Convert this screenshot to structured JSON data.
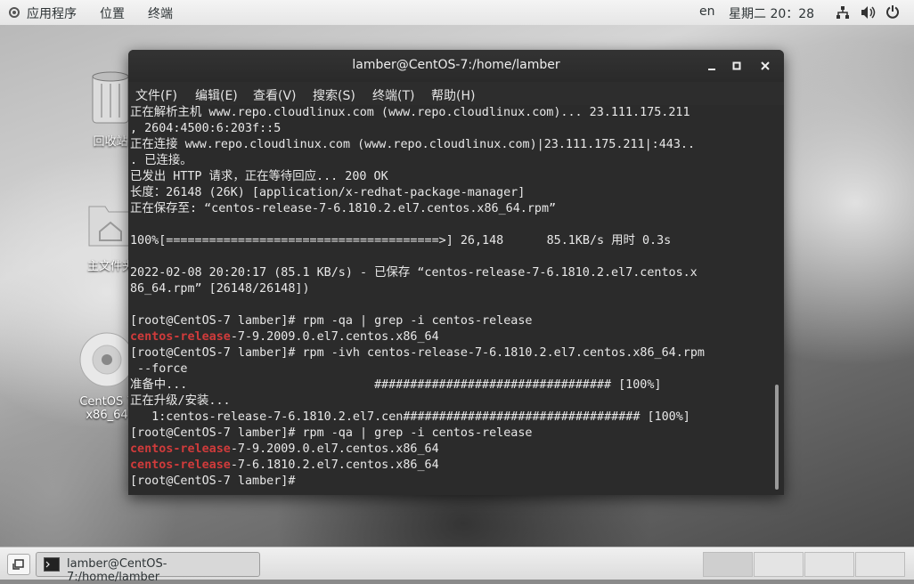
{
  "topbar": {
    "apps_label": "应用程序",
    "places_label": "位置",
    "terminal_label": "终端",
    "lang": "en",
    "clock": "星期二 20：28"
  },
  "desktop": {
    "icons": [
      {
        "label": "回收站"
      },
      {
        "label": "主文件夹"
      },
      {
        "label": "CentOS 7 x86_64"
      }
    ]
  },
  "window": {
    "title": "lamber@CentOS-7:/home/lamber",
    "menus": [
      "文件(F)",
      "编辑(E)",
      "查看(V)",
      "搜索(S)",
      "终端(T)",
      "帮助(H)"
    ]
  },
  "terminal": {
    "lines": [
      "正在解析主机 www.repo.cloudlinux.com (www.repo.cloudlinux.com)... 23.111.175.211",
      ", 2604:4500:6:203f::5",
      "正在连接 www.repo.cloudlinux.com (www.repo.cloudlinux.com)|23.111.175.211|:443..",
      ". 已连接。",
      "已发出 HTTP 请求，正在等待回应... 200 OK",
      "长度：26148 (26K) [application/x-redhat-package-manager]",
      "正在保存至: “centos-release-7-6.1810.2.el7.centos.x86_64.rpm”",
      "",
      "100%[======================================>] 26,148      85.1KB/s 用时 0.3s",
      "",
      "2022-02-08 20:20:17 (85.1 KB/s) - 已保存 “centos-release-7-6.1810.2.el7.centos.x",
      "86_64.rpm” [26148/26148])",
      "",
      "[root@CentOS-7 lamber]# rpm -qa | grep -i centos-release",
      "centos-release|-7-9.2009.0.el7.centos.x86_64",
      "[root@CentOS-7 lamber]# rpm -ivh centos-release-7-6.1810.2.el7.centos.x86_64.rpm",
      " --force",
      "准备中...                          ################################# [100%]",
      "正在升级/安装...",
      "   1:centos-release-7-6.1810.2.el7.cen################################# [100%]",
      "[root@CentOS-7 lamber]# rpm -qa | grep -i centos-release",
      "centos-release|-7-9.2009.0.el7.centos.x86_64",
      "centos-release|-7-6.1810.2.el7.centos.x86_64",
      "[root@CentOS-7 lamber]# "
    ]
  },
  "taskbar": {
    "task_label": "lamber@CentOS-7:/home/lamber"
  }
}
